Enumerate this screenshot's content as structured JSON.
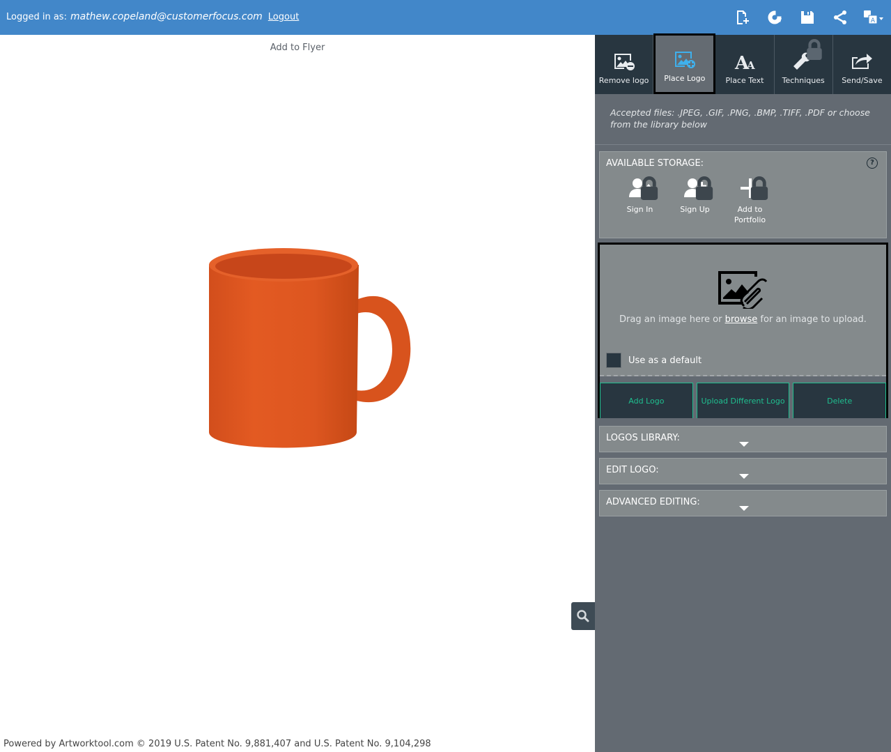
{
  "header": {
    "logged_in_label": "Logged in as:",
    "email": "mathew.copeland@customerfocus.com",
    "logout": "Logout",
    "icons": [
      "new-page-icon",
      "refresh-icon",
      "save-icon",
      "share-icon",
      "language-icon"
    ]
  },
  "canvas": {
    "title": "Add to Flyer",
    "product": "orange-mug",
    "product_color": "#e0541c"
  },
  "footer": {
    "text": "Powered by Artworktool.com © 2019 U.S. Patent No. 9,881,407 and U.S. Patent No. 9,104,298"
  },
  "tools": [
    {
      "label": "Remove logo",
      "icon": "remove-image-icon",
      "active": false,
      "locked": false
    },
    {
      "label": "Place Logo",
      "icon": "add-image-icon",
      "active": true,
      "locked": false
    },
    {
      "label": "Place Text",
      "icon": "text-icon",
      "active": false,
      "locked": false
    },
    {
      "label": "Techniques",
      "icon": "wrench-icon",
      "active": false,
      "locked": true
    },
    {
      "label": "Send/Save",
      "icon": "share-out-icon",
      "active": false,
      "locked": false
    }
  ],
  "accepted_files": "Accepted files: .JPEG, .GIF, .PNG, .BMP, .TIFF, .PDF or choose from the library below",
  "storage": {
    "title": "AVAILABLE STORAGE:",
    "help": "?",
    "items": [
      {
        "label": "Sign In",
        "icon": "user-upload-icon",
        "locked": true
      },
      {
        "label": "Sign Up",
        "icon": "user-add-icon",
        "locked": true
      },
      {
        "label": "Add to Portfolio",
        "icon": "plus-icon",
        "locked": true
      }
    ]
  },
  "upload": {
    "text_before": "Drag an image here or ",
    "browse": "browse",
    "text_after": " for an image to upload.",
    "default_label": "Use as a default",
    "default_checked": false,
    "actions": [
      "Add Logo",
      "Upload Different Logo",
      "Delete"
    ]
  },
  "sections": [
    "LOGOS LIBRARY:",
    "EDIT LOGO:",
    "ADVANCED EDITING:"
  ],
  "colors": {
    "header": "#4287c9",
    "toolbar": "#283640",
    "panel": "#636a72",
    "section": "#848a8c",
    "accent": "#1fbf8f",
    "active_icon": "#3fb0ec"
  }
}
